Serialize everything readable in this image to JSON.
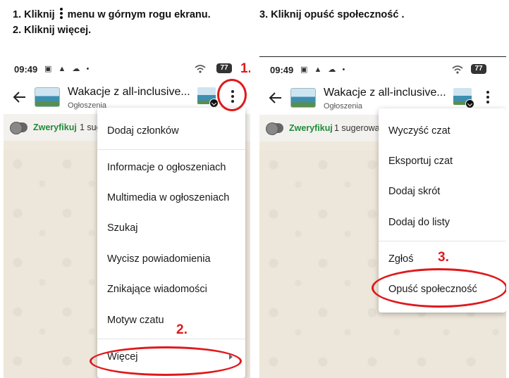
{
  "instructions": {
    "step1_before": "1. Kliknij",
    "step1_after": "menu  w górnym rogu ekranu.",
    "step2": "2. Kliknij więcej.",
    "step3": "3. Kliknij opuść społeczność ."
  },
  "status_bar": {
    "time": "09:49",
    "battery": "77",
    "icons": [
      "screenshot-icon",
      "warning-icon",
      "cloud-icon",
      "dot-icon",
      "wifi-icon",
      "battery-icon"
    ]
  },
  "chat": {
    "title": "Wakacje z all-inclusive...",
    "subtitle": "Ogłoszenia",
    "verify_label": "Zweryfikuj",
    "verify_rest_left": "1 sug",
    "verify_rest_right": "1 sugerowa"
  },
  "menu_main": {
    "items": [
      "Dodaj członków",
      "Informacje o ogłoszeniach",
      "Multimedia w ogłoszeniach",
      "Szukaj",
      "Wycisz powiadomienia",
      "Znikające wiadomości",
      "Motyw czatu",
      "Więcej"
    ]
  },
  "menu_more": {
    "items": [
      "Wyczyść czat",
      "Eksportuj czat",
      "Dodaj skrót",
      "Dodaj do listy",
      "Zgłoś",
      "Opuść społeczność"
    ]
  },
  "annotations": {
    "step1": "1.",
    "step2": "2.",
    "step3": "3."
  },
  "colors": {
    "annotation_red": "#e0191b",
    "verify_green": "#1e8c3a",
    "wallpaper": "#ede6da"
  }
}
